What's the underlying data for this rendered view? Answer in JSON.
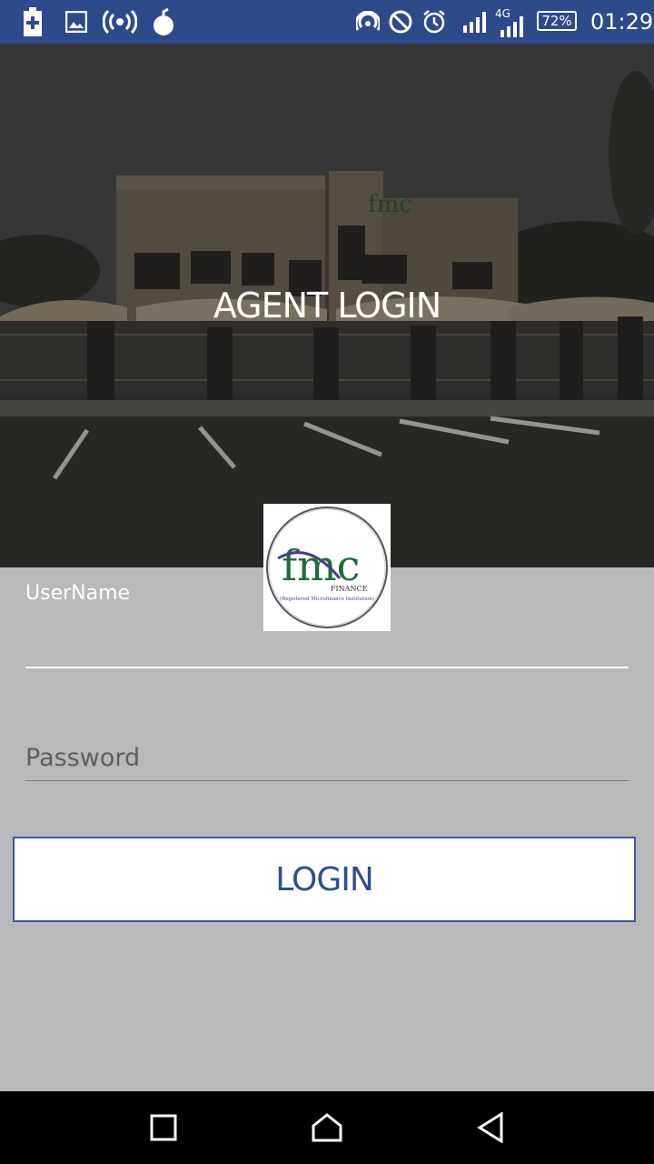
{
  "status_bar": {
    "time": "01:29",
    "battery_percent": "72%",
    "network_label": "4G",
    "icons": [
      "battery-charging-icon",
      "image-icon",
      "hotspot-icon",
      "app-bomb-icon",
      "nfc-icon",
      "do-not-disturb-icon",
      "alarm-icon",
      "signal-icon",
      "signal-4g-icon"
    ]
  },
  "hero": {
    "title": "AGENT LOGIN",
    "building_sign": "fmc"
  },
  "logo": {
    "brand": "fmc",
    "subtitle": "FINANCE",
    "tagline": "(Registered Microfinance Institution)"
  },
  "form": {
    "username_label": "UserName",
    "username_value": "",
    "password_placeholder": "Password",
    "login_label": "LOGIN"
  },
  "colors": {
    "status_bar": "#2d4a8a",
    "background": "#b9b9b9",
    "accent": "#2e4d96",
    "logo_green": "#1f6b3a"
  },
  "nav_bar": {
    "icons": [
      "recents-icon",
      "home-icon",
      "back-icon"
    ]
  }
}
